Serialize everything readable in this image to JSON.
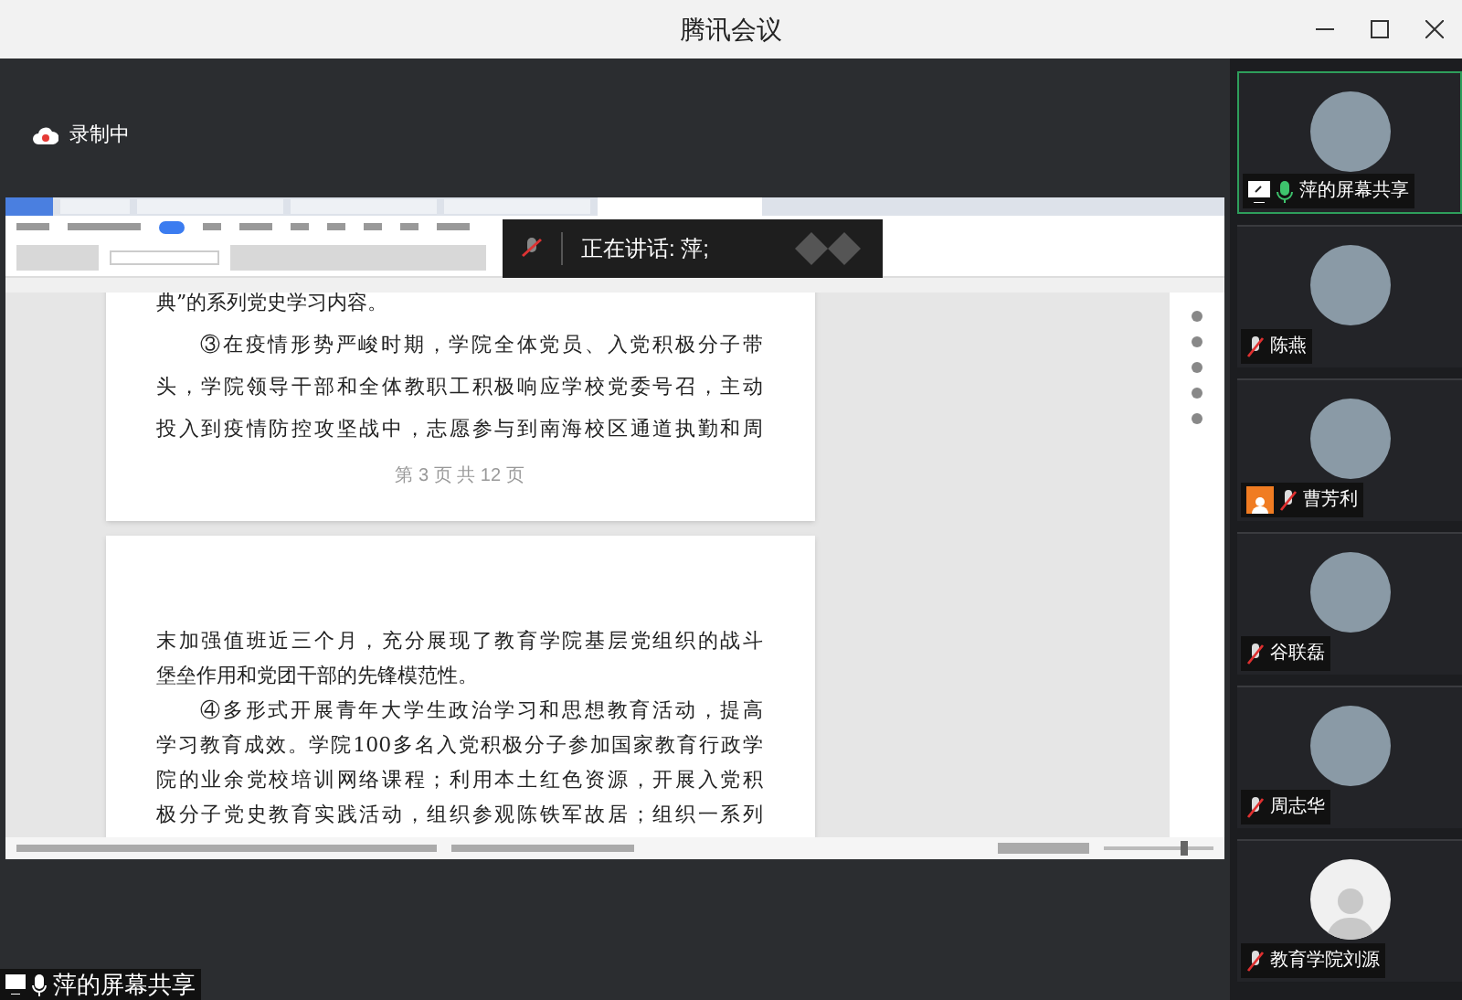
{
  "window": {
    "title": "腾讯会议"
  },
  "recording": {
    "label": "录制中"
  },
  "speaking_banner": {
    "label": "正在讲话: 萍;"
  },
  "document": {
    "pages": [
      {
        "lines": [
          {
            "text": "典”的系列党史学习内容。",
            "indent": false,
            "full": false
          },
          {
            "text": "③在疫情形势严峻时期，学院全体党员、入党积极分子带",
            "indent": true,
            "full": true
          },
          {
            "text": "头，学院领导干部和全体教职工积极响应学校党委号召，主动",
            "indent": false,
            "full": true
          },
          {
            "text": "投入到疫情防控攻坚战中，志愿参与到南海校区通道执勤和周",
            "indent": false,
            "full": true
          }
        ],
        "footer": "第 3 页 共 12 页"
      },
      {
        "lines": [
          {
            "text": "末加强值班近三个月，充分展现了教育学院基层党组织的战斗",
            "indent": false,
            "full": true
          },
          {
            "text": "堡垒作用和党团干部的先锋模范性。",
            "indent": false,
            "full": false
          },
          {
            "text": "④多形式开展青年大学生政治学习和思想教育活动，提高",
            "indent": true,
            "full": true
          },
          {
            "text": "学习教育成效。学院100多名入党积极分子参加国家教育行政学",
            "indent": false,
            "full": true
          },
          {
            "text": "院的业余党校培训网络课程；利用本土红色资源，开展入党积",
            "indent": false,
            "full": true
          },
          {
            "text": "极分子党史教育实践活动，组织参观陈铁军故居；组织一系列",
            "indent": false,
            "full": true
          }
        ]
      }
    ],
    "zoom_slider": {
      "level": 0.75
    }
  },
  "presenter_label": {
    "label": "萍的屏幕共享"
  },
  "participants": [
    {
      "name": "萍的屏幕共享",
      "kind": "photo",
      "speaking": true,
      "sharing": true,
      "host": false,
      "muted": false
    },
    {
      "name": "陈燕",
      "kind": "photo",
      "speaking": false,
      "sharing": false,
      "host": false,
      "muted": true
    },
    {
      "name": "曹芳利",
      "kind": "photo",
      "speaking": false,
      "sharing": false,
      "host": true,
      "muted": true
    },
    {
      "name": "谷联磊",
      "kind": "photo",
      "speaking": false,
      "sharing": false,
      "host": false,
      "muted": true
    },
    {
      "name": "周志华",
      "kind": "photo",
      "speaking": false,
      "sharing": false,
      "host": false,
      "muted": true
    },
    {
      "name": "教育学院刘源",
      "kind": "default",
      "speaking": false,
      "sharing": false,
      "host": false,
      "muted": true
    }
  ]
}
